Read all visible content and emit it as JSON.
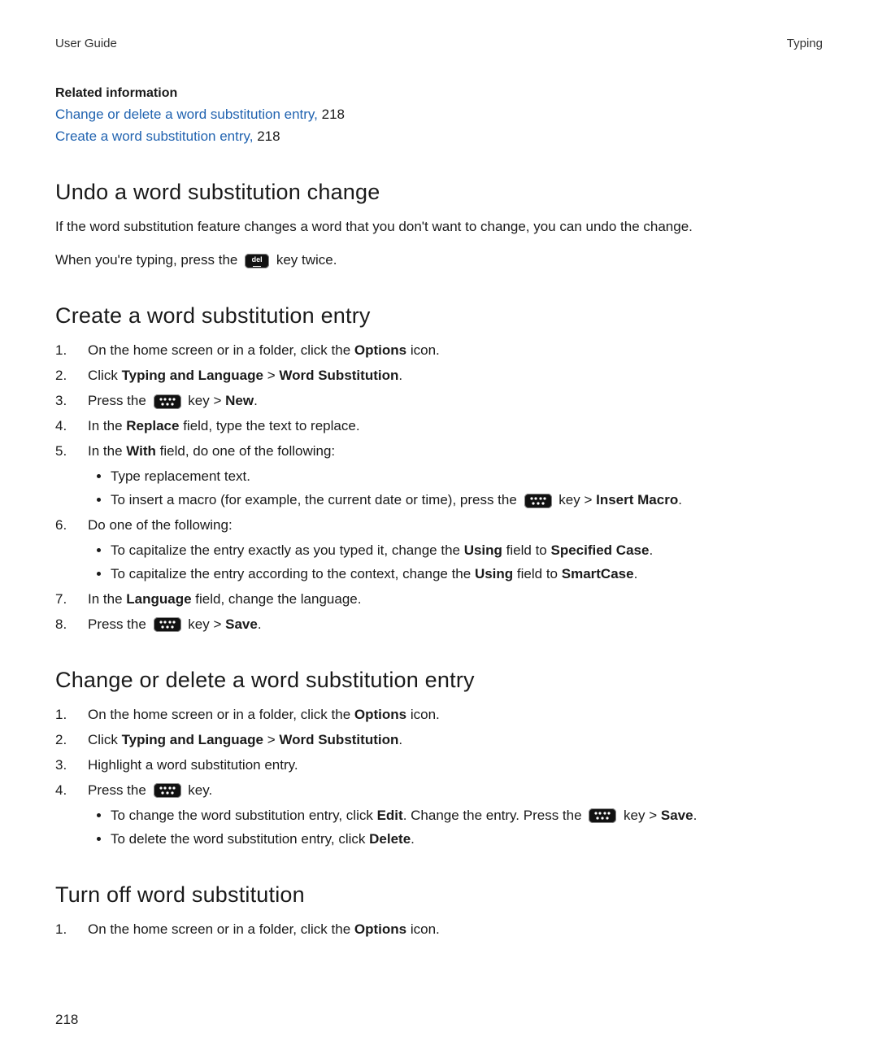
{
  "header": {
    "left": "User Guide",
    "right": "Typing"
  },
  "related": {
    "title": "Related information",
    "links": [
      {
        "text": "Change or delete a word substitution entry,",
        "page": "218"
      },
      {
        "text": "Create a word substitution entry,",
        "page": "218"
      }
    ]
  },
  "sec1": {
    "heading": "Undo a word substitution change",
    "p1": "If the word substitution feature changes a word that you don't want to change, you can undo the change.",
    "p2a": "When you're typing, press the ",
    "p2b": " key twice.",
    "del_label": "del"
  },
  "sec2": {
    "heading": "Create a word substitution entry",
    "s1a": "On the home screen or in a folder, click the ",
    "s1b": "Options",
    "s1c": " icon.",
    "s2a": "Click ",
    "s2b": "Typing and Language",
    "s2c": " > ",
    "s2d": "Word Substitution",
    "s2e": ".",
    "s3a": "Press the ",
    "s3b": " key > ",
    "s3c": "New",
    "s3d": ".",
    "s4a": "In the ",
    "s4b": "Replace",
    "s4c": " field, type the text to replace.",
    "s5a": "In the ",
    "s5b": "With",
    "s5c": " field, do one of the following:",
    "s5_b1": "Type replacement text.",
    "s5_b2a": "To insert a macro (for example, the current date or time), press the ",
    "s5_b2b": " key > ",
    "s5_b2c": "Insert Macro",
    "s5_b2d": ".",
    "s6": "Do one of the following:",
    "s6_b1a": "To capitalize the entry exactly as you typed it, change the ",
    "s6_b1b": "Using",
    "s6_b1c": " field to ",
    "s6_b1d": "Specified Case",
    "s6_b1e": ".",
    "s6_b2a": "To capitalize the entry according to the context, change the ",
    "s6_b2b": "Using",
    "s6_b2c": " field to ",
    "s6_b2d": "SmartCase",
    "s6_b2e": ".",
    "s7a": "In the ",
    "s7b": "Language",
    "s7c": " field, change the language.",
    "s8a": "Press the ",
    "s8b": " key > ",
    "s8c": "Save",
    "s8d": "."
  },
  "sec3": {
    "heading": "Change or delete a word substitution entry",
    "s1a": "On the home screen or in a folder, click the ",
    "s1b": "Options",
    "s1c": " icon.",
    "s2a": "Click ",
    "s2b": "Typing and Language",
    "s2c": " > ",
    "s2d": "Word Substitution",
    "s2e": ".",
    "s3": "Highlight a word substitution entry.",
    "s4a": "Press the ",
    "s4b": " key.",
    "s4_b1a": "To change the word substitution entry, click ",
    "s4_b1b": "Edit",
    "s4_b1c": ". Change the entry. Press the ",
    "s4_b1d": " key > ",
    "s4_b1e": "Save",
    "s4_b1f": ".",
    "s4_b2a": "To delete the word substitution entry, click ",
    "s4_b2b": "Delete",
    "s4_b2c": "."
  },
  "sec4": {
    "heading": "Turn off word substitution",
    "s1a": "On the home screen or in a folder, click the ",
    "s1b": "Options",
    "s1c": " icon."
  },
  "page_number": "218"
}
